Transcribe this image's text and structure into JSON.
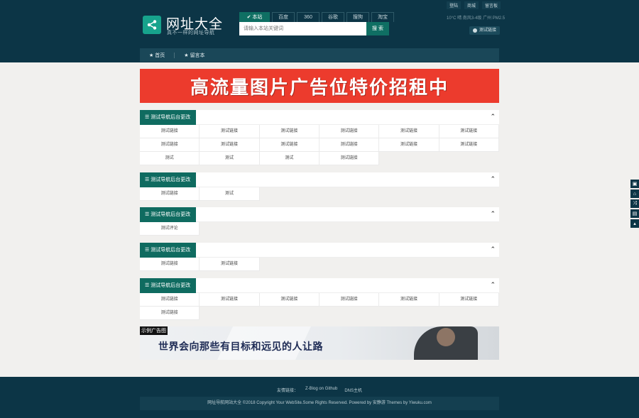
{
  "header": {
    "site_title": "网址大全",
    "site_subtitle": "真不一样的网址导航",
    "search_tabs": [
      "本站",
      "百度",
      "360",
      "谷歌",
      "搜狗",
      "淘宝"
    ],
    "search_placeholder": "请输入本站关键词",
    "search_button": "搜 索",
    "top_links": [
      "登陆",
      "商城",
      "留言板"
    ],
    "weather": "10°C 晴 南风3-4级 广州 PM2.5",
    "test_link_button": "测试链接"
  },
  "nav": {
    "items": [
      "首页",
      "留言本"
    ]
  },
  "banner_top": {
    "text": "高流量图片广告位特价招租中"
  },
  "sections": [
    {
      "title": "测试导航后台更改",
      "links": [
        "测试链接",
        "测试链接",
        "测试链接",
        "测试链接",
        "测试链接",
        "测试链接",
        "测试链接",
        "测试链接",
        "测试链接",
        "测试链接",
        "测试链接",
        "测试链接",
        "测试",
        "测试",
        "测试",
        "测试链接"
      ]
    },
    {
      "title": "测试导航后台更改",
      "links": [
        "测试链接",
        "测试"
      ]
    },
    {
      "title": "测试导航后台更改",
      "links": [
        "测试评论"
      ]
    },
    {
      "title": "测试导航后台更改",
      "links": [
        "测试链接",
        "测试链接"
      ]
    },
    {
      "title": "测试导航后台更改",
      "links": [
        "测试链接",
        "测试链接",
        "测试链接",
        "测试链接",
        "测试链接",
        "测试链接",
        "测试链接"
      ]
    }
  ],
  "banner_bottom": {
    "label": "示例广告图",
    "slogan": "世界会向那些有目标和远见的人让路"
  },
  "footer": {
    "links_label": "友情链接：",
    "links": [
      "Z-Blog on Github",
      "DNS主机"
    ],
    "copyright": "网址导航网站大全 ©2018 Copyright Your WebSite.Some Rights Reserved. Powered by 安静游 Themes by Yiwuku.com"
  },
  "colors": {
    "header_bg": "#0c3546",
    "accent": "#0f6b60",
    "banner_red": "#ec3b2d"
  }
}
